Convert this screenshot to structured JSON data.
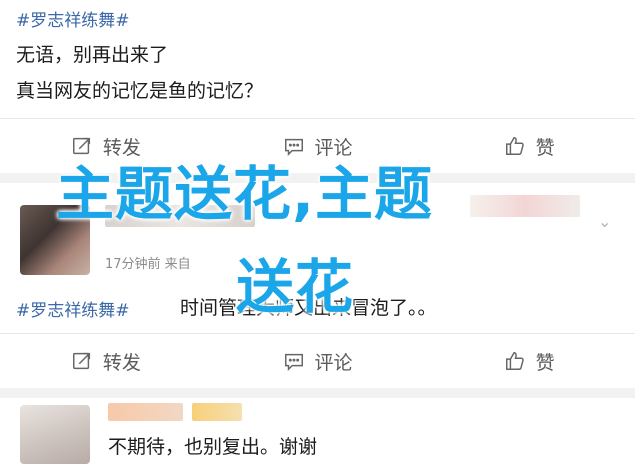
{
  "post1": {
    "hashtag": "#罗志祥练舞#",
    "line1": "无语，别再出来了",
    "line2": "真当网友的记忆是鱼的记忆？"
  },
  "actions1": {
    "repost": "转发",
    "comment": "评论",
    "like": "赞"
  },
  "overlay": {
    "line1": "主题送花,主题",
    "line2": "送花"
  },
  "post2": {
    "meta": "17分钟前 来自",
    "hashtag": "#罗志祥练舞#",
    "text": "时间管理大师又出来冒泡了。。"
  },
  "actions2": {
    "repost": "转发",
    "comment": "评论",
    "like": "赞"
  },
  "post3": {
    "text": "不期待，也别复出。谢谢"
  },
  "colors": {
    "hashtag": "#3c68a8",
    "overlay": "#1aa6e8",
    "action_text": "#5a5a5a"
  }
}
